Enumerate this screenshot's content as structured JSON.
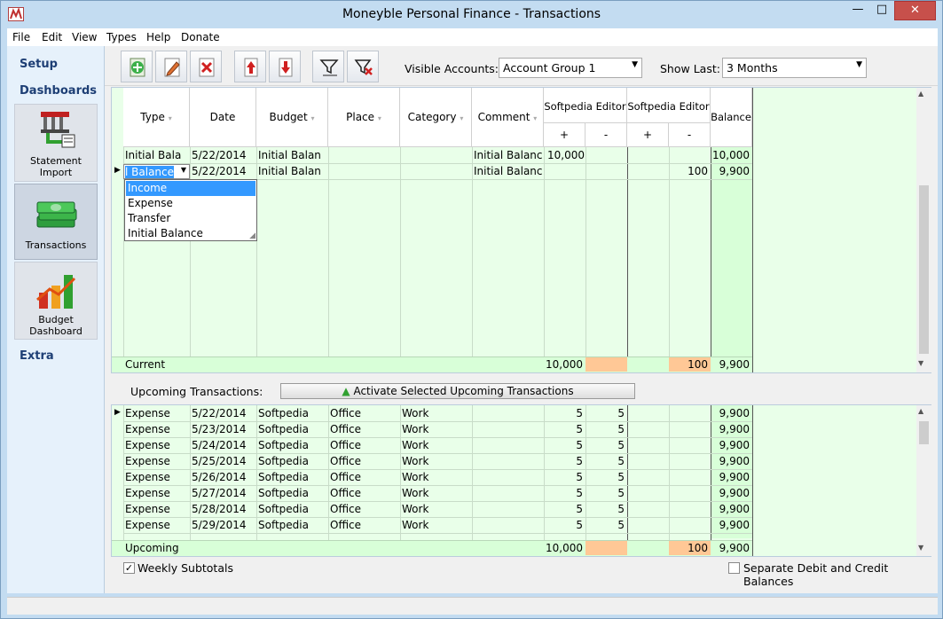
{
  "window": {
    "title": "Moneyble Personal Finance - Transactions",
    "min": "—",
    "max": "□",
    "close": "✕"
  },
  "menu": [
    "File",
    "Edit",
    "View",
    "Types",
    "Help",
    "Donate"
  ],
  "sidebar": {
    "setup": "Setup",
    "dashboards": "Dashboards",
    "buttons": [
      {
        "line1": "Statement",
        "line2": "Import"
      },
      {
        "line1": "Transactions",
        "line2": ""
      },
      {
        "line1": "Budget",
        "line2": "Dashboard"
      }
    ],
    "extra": "Extra"
  },
  "toolbar": {
    "visible_accounts_label": "Visible Accounts:",
    "visible_accounts_value": "Account Group 1",
    "show_last_label": "Show Last:",
    "show_last_value": "3 Months",
    "icons": [
      "add-icon",
      "edit-icon",
      "delete-icon",
      "move-up-icon",
      "move-down-icon",
      "filter-icon",
      "clear-filter-icon"
    ]
  },
  "grid": {
    "headers": [
      "Type",
      "Date",
      "Budget",
      "Place",
      "Category",
      "Comment"
    ],
    "account_headers": [
      "Softpedia Editor",
      "Softpedia Editor"
    ],
    "sub_headers": [
      "+",
      "-",
      "+",
      "-"
    ],
    "balance_header": "Balance",
    "rows": [
      {
        "type": "Initial Bala",
        "date": "5/22/2014",
        "budget": "Initial Balan",
        "place": "",
        "category": "",
        "comment": "Initial Balance",
        "a_plus": "10,000",
        "a_minus": "",
        "b_plus": "",
        "b_minus": "",
        "balance": "10,000"
      },
      {
        "type": "l Balance",
        "date": "5/22/2014",
        "budget": "Initial Balan",
        "place": "",
        "category": "",
        "comment": "Initial Balance",
        "a_plus": "",
        "a_minus": "",
        "b_plus": "",
        "b_minus": "100",
        "balance": "9,900"
      }
    ],
    "dropdown": [
      "Income",
      "Expense",
      "Transfer",
      "Initial Balance"
    ],
    "footer": {
      "label": "Current",
      "a_plus": "10,000",
      "b_minus": "100",
      "balance": "9,900"
    }
  },
  "upcoming": {
    "label": "Upcoming Transactions:",
    "button": "Activate Selected Upcoming Transactions",
    "rows": [
      {
        "type": "Expense",
        "date": "5/22/2014",
        "budget": "Softpedia",
        "place": "Office",
        "category": "Work",
        "a_plus": "5",
        "a_minus": "5",
        "balance": "9,900"
      },
      {
        "type": "Expense",
        "date": "5/23/2014",
        "budget": "Softpedia",
        "place": "Office",
        "category": "Work",
        "a_plus": "5",
        "a_minus": "5",
        "balance": "9,900"
      },
      {
        "type": "Expense",
        "date": "5/24/2014",
        "budget": "Softpedia",
        "place": "Office",
        "category": "Work",
        "a_plus": "5",
        "a_minus": "5",
        "balance": "9,900"
      },
      {
        "type": "Expense",
        "date": "5/25/2014",
        "budget": "Softpedia",
        "place": "Office",
        "category": "Work",
        "a_plus": "5",
        "a_minus": "5",
        "balance": "9,900"
      },
      {
        "type": "Expense",
        "date": "5/26/2014",
        "budget": "Softpedia",
        "place": "Office",
        "category": "Work",
        "a_plus": "5",
        "a_minus": "5",
        "balance": "9,900"
      },
      {
        "type": "Expense",
        "date": "5/27/2014",
        "budget": "Softpedia",
        "place": "Office",
        "category": "Work",
        "a_plus": "5",
        "a_minus": "5",
        "balance": "9,900"
      },
      {
        "type": "Expense",
        "date": "5/28/2014",
        "budget": "Softpedia",
        "place": "Office",
        "category": "Work",
        "a_plus": "5",
        "a_minus": "5",
        "balance": "9,900"
      },
      {
        "type": "Expense",
        "date": "5/29/2014",
        "budget": "Softpedia",
        "place": "Office",
        "category": "Work",
        "a_plus": "5",
        "a_minus": "5",
        "balance": "9,900"
      }
    ],
    "footer": {
      "label": "Upcoming",
      "a_plus": "10,000",
      "b_minus": "100",
      "balance": "9,900"
    }
  },
  "options": {
    "weekly_subtotals": "Weekly Subtotals",
    "separate_balances": "Separate Debit and Credit Balances",
    "weekly_checked": "✓"
  },
  "colors": {
    "grid_bg": "#e9ffe9",
    "balance_col": "#d8ffd8",
    "orange_total": "#ffc896",
    "selection": "#3399ff",
    "sidebar_head": "#1e3f75"
  }
}
